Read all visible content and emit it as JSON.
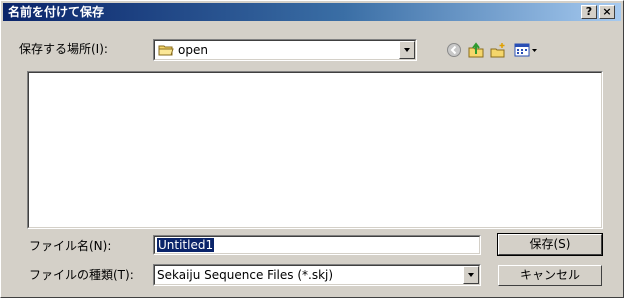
{
  "window": {
    "title": "名前を付けて保存"
  },
  "titlebar": {
    "help": "?",
    "close": "×"
  },
  "location": {
    "label": "保存する場所(I):",
    "value": "open"
  },
  "filename": {
    "label": "ファイル名(N):",
    "value": "Untitled1"
  },
  "filetype": {
    "label": "ファイルの種類(T):",
    "value": "Sekaiju Sequence Files (*.skj)"
  },
  "buttons": {
    "save": "保存(S)",
    "cancel": "キャンセル"
  },
  "toolbar_icons": [
    "back-icon",
    "up-folder-icon",
    "new-folder-icon",
    "view-menu-icon"
  ],
  "colors": {
    "titlebar_start": "#0a246a",
    "titlebar_end": "#a6caf0",
    "face": "#d4d0c8",
    "selection": "#0a246a"
  }
}
